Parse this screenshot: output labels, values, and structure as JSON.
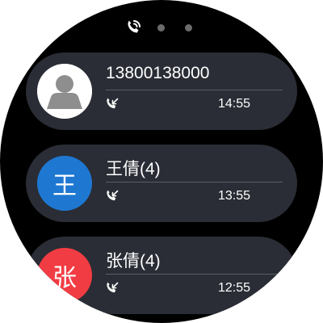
{
  "pager": {
    "icon": "incoming-call-icon",
    "page_count": 3,
    "active_page": 1
  },
  "calls": [
    {
      "name": "13800138000",
      "avatar_type": "contact-placeholder-icon",
      "avatar_bg": "#ffffff",
      "call_type_icon": "incoming-call-icon",
      "time": "14:55"
    },
    {
      "name": "王倩(4)",
      "avatar_text": "王",
      "avatar_bg": "#1e78d2",
      "call_type_icon": "incoming-call-icon",
      "time": "13:55"
    },
    {
      "name": "张倩(4)",
      "avatar_text": "张",
      "avatar_bg": "#f23c43",
      "call_type_icon": "incoming-call-icon",
      "time": "12:55"
    }
  ],
  "colors": {
    "background": "#000000",
    "card": "#2a2d35",
    "text": "#ffffff",
    "divider": "#5a5d66"
  }
}
